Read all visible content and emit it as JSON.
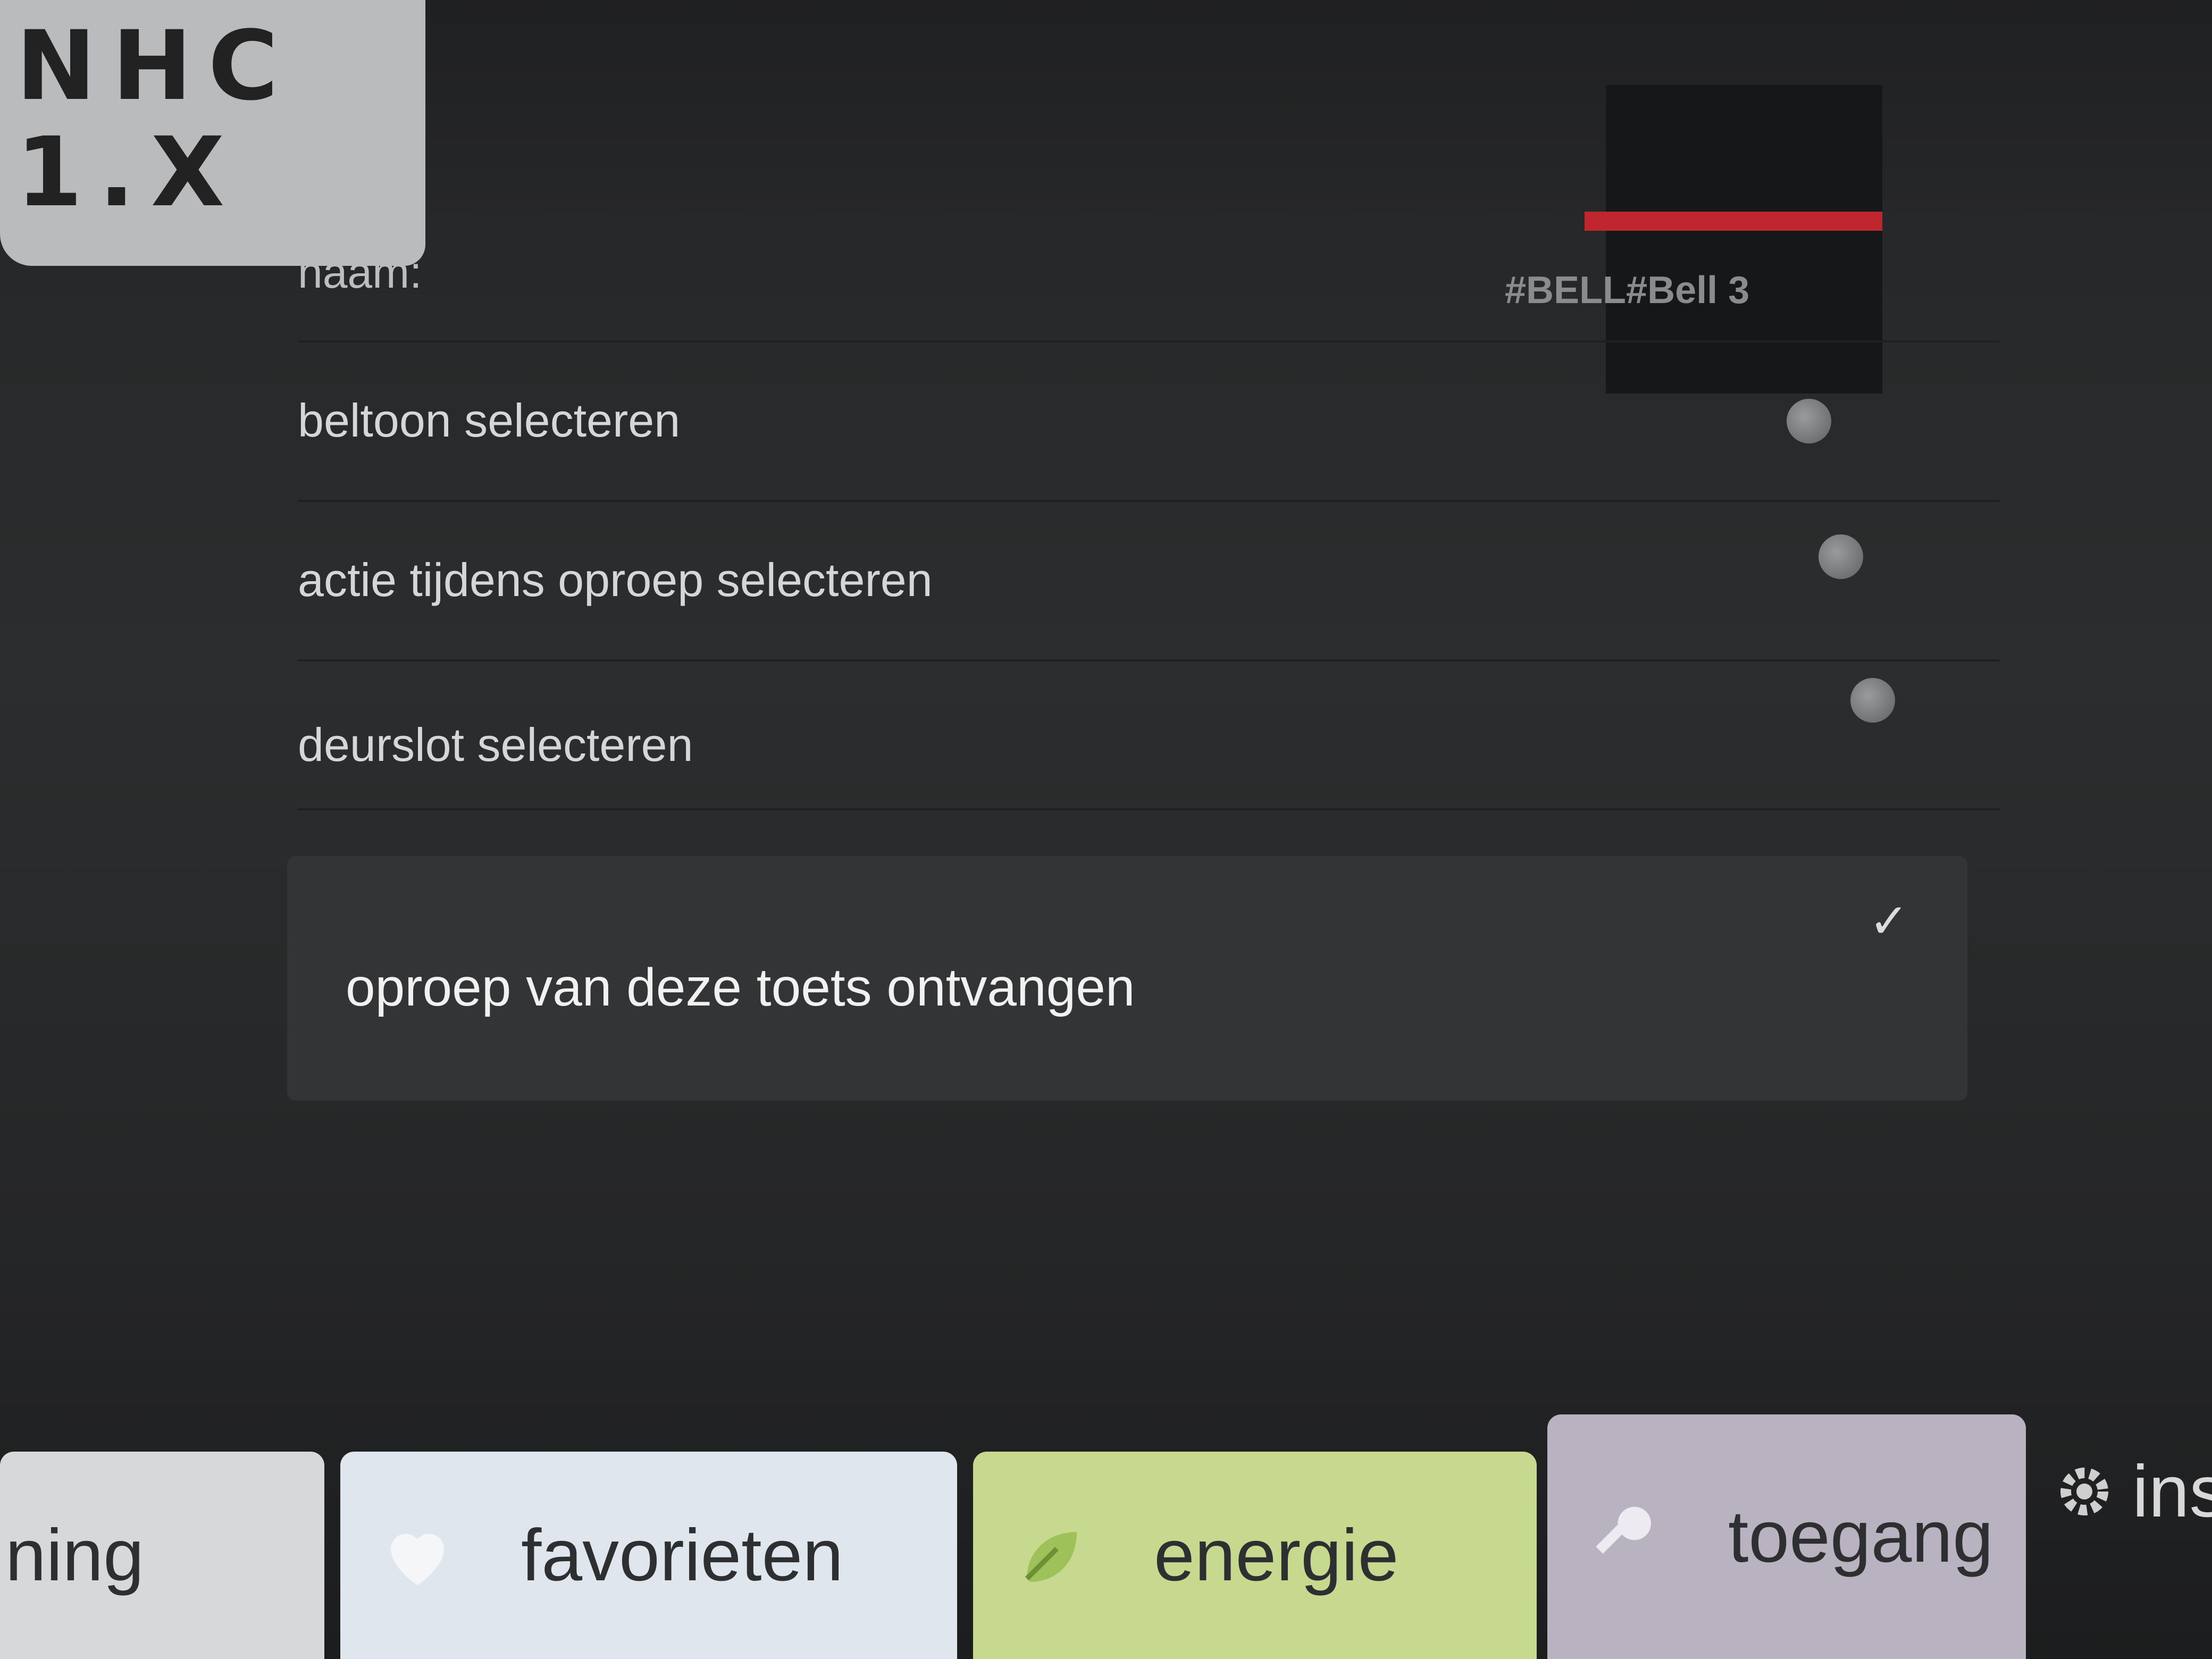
{
  "sticky_note": {
    "line1": "NHC",
    "line2": "1.X"
  },
  "form": {
    "name_label": "naam:",
    "name_value": "#BELL#Bell 3",
    "rows": [
      {
        "label": "beltoon selecteren"
      },
      {
        "label": "actie tijdens oproep selecteren"
      },
      {
        "label": "deurslot selecteren"
      }
    ],
    "checkbox": {
      "label": "oproep van deze toets ontvangen",
      "checked": true,
      "check_glyph": "✓"
    }
  },
  "tabs": [
    {
      "label": "ning",
      "icon": "none",
      "color": "#d6d8da"
    },
    {
      "label": "favorieten",
      "icon": "heart-icon",
      "color": "#dfe6ee"
    },
    {
      "label": "energie",
      "icon": "leaf-icon",
      "color": "#c6d98f"
    },
    {
      "label": "toegang",
      "icon": "key-icon",
      "color": "#b9b3c1"
    },
    {
      "label": "ins",
      "icon": "gear-icon",
      "color": "#d8d8d8"
    }
  ],
  "colors": {
    "screen_bg": "#2a2c2d",
    "accent_red": "#c0262e",
    "text_primary": "#f1f1f1"
  }
}
